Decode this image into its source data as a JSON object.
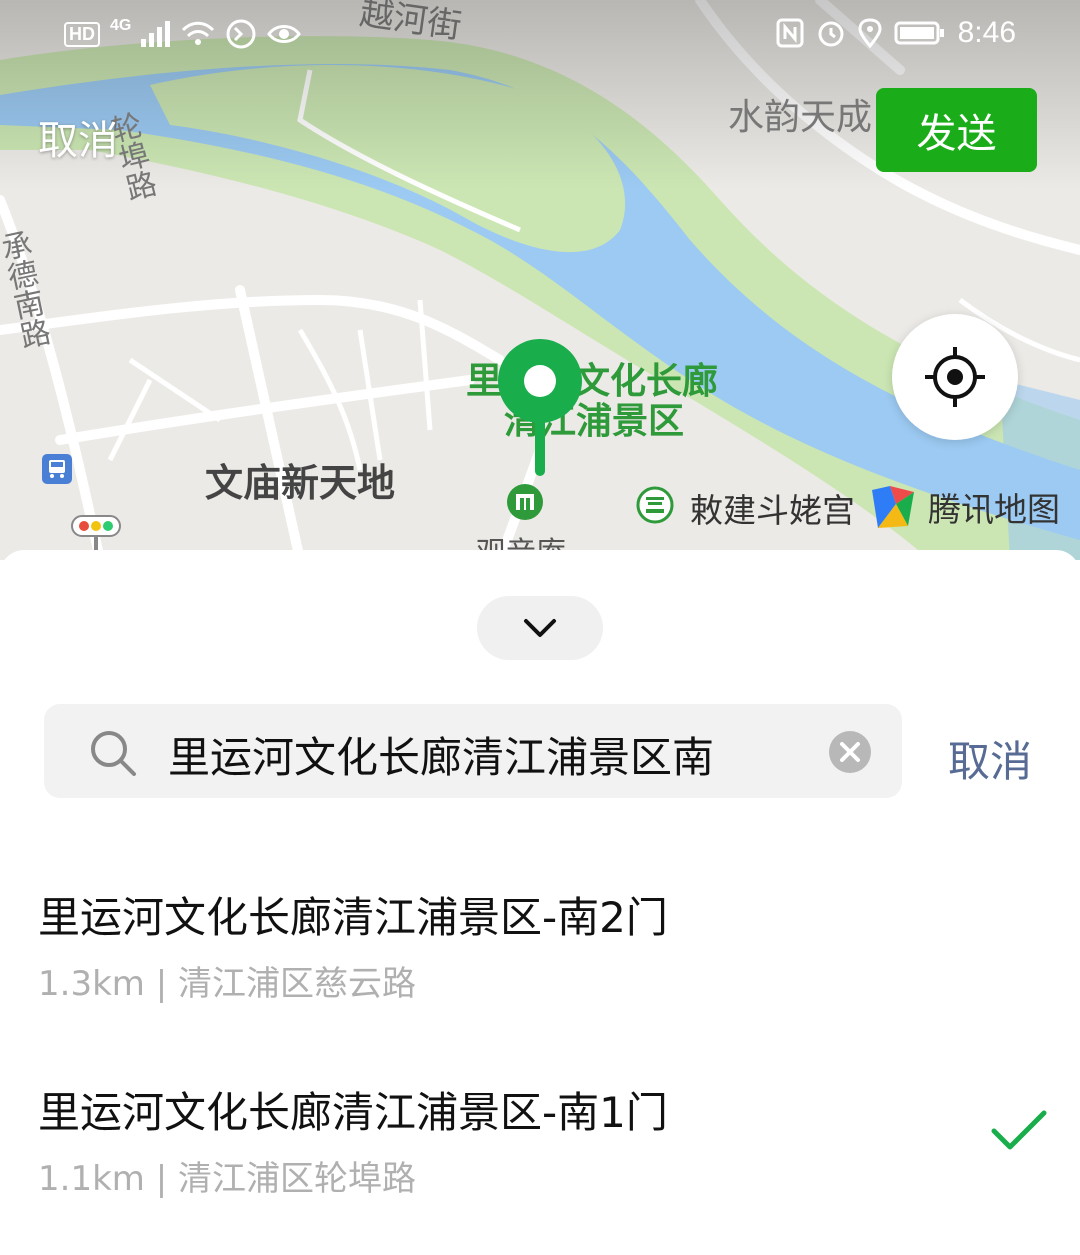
{
  "status_bar": {
    "left_indicators": [
      "HD",
      "4G",
      "signal-icon",
      "wifi-icon",
      "app-notification-icon",
      "eye-icon"
    ],
    "right_indicators": [
      "nfc-icon",
      "alarm-icon",
      "location-icon",
      "battery-icon"
    ],
    "hd_label": "HD",
    "net_label": "4G",
    "time": "8:46"
  },
  "header": {
    "cancel_label": "取消",
    "send_label": "发送"
  },
  "map": {
    "labels": {
      "top_street": "越河街",
      "waterfront": "水韵天成",
      "road_a": "承德南路",
      "road_b": "轮埠路",
      "scenic_line1": "里运河文化长廊",
      "scenic_line2": "清江浦景区",
      "district": "文庙新天地",
      "palace": "敕建斗姥宫",
      "guanyin": "观音庵"
    },
    "logo_text": "腾讯地图",
    "colors": {
      "water": "#9ccaf2",
      "park": "#cbe6b3",
      "land": "#eceae6",
      "pin": "#1aad4c",
      "send": "#1aad19"
    }
  },
  "search": {
    "query": "里运河文化长廊清江浦景区南",
    "cancel_label": "取消"
  },
  "results": [
    {
      "title": "里运河文化长廊清江浦景区-南2门",
      "subtitle": "1.3km | 清江浦区慈云路",
      "selected": false
    },
    {
      "title": "里运河文化长廊清江浦景区-南1门",
      "subtitle": "1.1km | 清江浦区轮埠路",
      "selected": true
    }
  ]
}
